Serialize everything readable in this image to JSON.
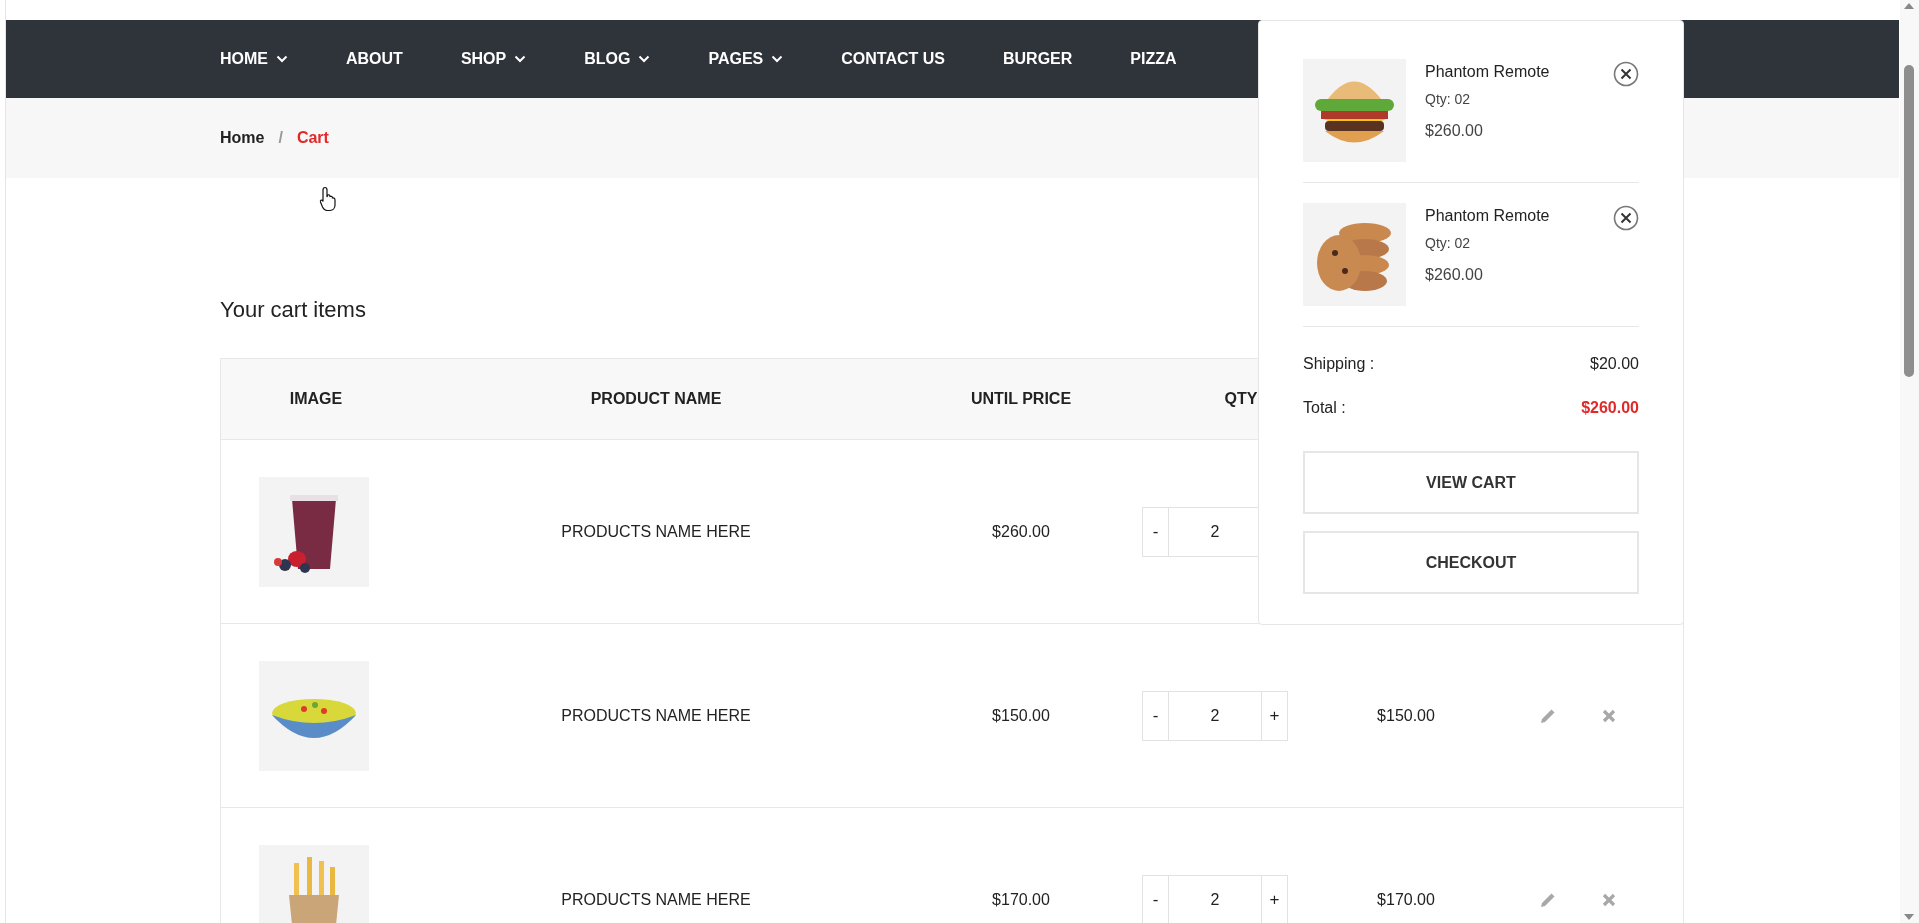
{
  "nav": {
    "items": [
      {
        "label": "HOME",
        "dropdown": true
      },
      {
        "label": "ABOUT",
        "dropdown": false
      },
      {
        "label": "SHOP",
        "dropdown": true
      },
      {
        "label": "BLOG",
        "dropdown": true
      },
      {
        "label": "PAGES",
        "dropdown": true
      },
      {
        "label": "CONTACT US",
        "dropdown": false
      },
      {
        "label": "BURGER",
        "dropdown": false
      },
      {
        "label": "PIZZA",
        "dropdown": false
      }
    ]
  },
  "breadcrumb": {
    "items": [
      {
        "label": "Home",
        "selected": false
      },
      {
        "label": "Cart",
        "selected": true
      }
    ],
    "separator": "/"
  },
  "heading": "Your cart items",
  "table": {
    "columns": [
      "IMAGE",
      "PRODUCT NAME",
      "UNTIL PRICE",
      "QTY"
    ],
    "rows": [
      {
        "name": "PRODUCTS NAME HERE",
        "price": "$260.00",
        "minus": "-",
        "qty": "2"
      },
      {
        "name": "PRODUCTS NAME HERE",
        "price": "$150.00",
        "minus": "-",
        "qty": "2",
        "plus": "+",
        "subtotal": "$150.00",
        "actions": true
      },
      {
        "name": "PRODUCTS NAME HERE",
        "price": "$170.00",
        "minus": "-",
        "qty": "2",
        "plus": "+",
        "subtotal": "$170.00",
        "actions": true
      }
    ]
  },
  "mini_cart": {
    "items": [
      {
        "name": "Phantom Remote",
        "qty": "Qty: 02",
        "price": "$260.00"
      },
      {
        "name": "Phantom Remote",
        "qty": "Qty: 02",
        "price": "$260.00"
      }
    ],
    "shipping_label": "Shipping :",
    "shipping": "$20.00",
    "total_label": "Total :",
    "total": "$260.00",
    "buttons": [
      "VIEW CART",
      "CHECKOUT"
    ]
  }
}
